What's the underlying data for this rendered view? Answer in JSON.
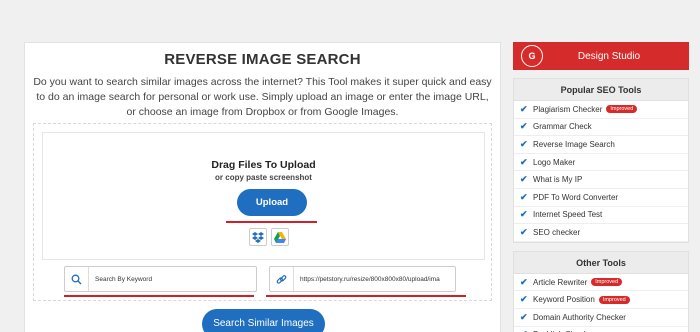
{
  "main": {
    "title": "REVERSE IMAGE SEARCH",
    "description": "Do you want to search similar images across the internet? This Tool makes it super quick and easy to do an image search for personal or work use. Simply upload an image or enter the image URL, or choose an image from Dropbox or from Google Images.",
    "drag_title": "Drag Files To Upload",
    "drag_sub": "or copy paste screenshot",
    "upload_label": "Upload",
    "keyword_value": "Search By Keyword",
    "url_value": "https://petstory.ru/resize/800x800x80/upload/ima",
    "search_label": "Search Similar Images"
  },
  "sidebar": {
    "brand_logo": "G",
    "brand_name": "Design Studio",
    "popular_title": "Popular SEO Tools",
    "popular_items": [
      {
        "label": "Plagiarism Checker",
        "badge": "Improved"
      },
      {
        "label": "Grammar Check",
        "badge": ""
      },
      {
        "label": "Reverse Image Search",
        "badge": ""
      },
      {
        "label": "Logo Maker",
        "badge": ""
      },
      {
        "label": "What is My IP",
        "badge": ""
      },
      {
        "label": "PDF To Word Converter",
        "badge": ""
      },
      {
        "label": "Internet Speed Test",
        "badge": ""
      },
      {
        "label": "SEO checker",
        "badge": ""
      }
    ],
    "other_title": "Other Tools",
    "other_items": [
      {
        "label": "Article Rewriter",
        "badge": "Improved"
      },
      {
        "label": "Keyword Position",
        "badge": "Improved"
      },
      {
        "label": "Domain Authority Checker",
        "badge": ""
      },
      {
        "label": "Backlink Checker",
        "badge": ""
      }
    ]
  },
  "colors": {
    "accent": "#1f6ebf",
    "brand": "#d62b2b",
    "underline": "#d0202a"
  }
}
